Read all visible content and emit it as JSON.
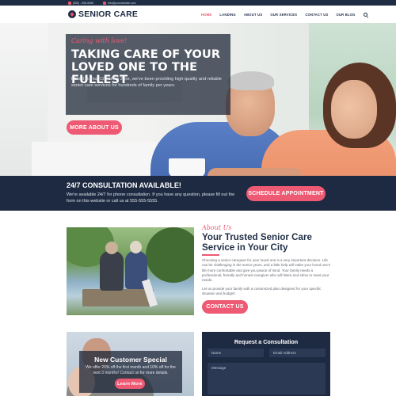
{
  "topbar": {
    "phone": "(555) - 555-5555",
    "email": "info@yourwebsite.com"
  },
  "header": {
    "logo_text": "SENIOR CARE",
    "nav": [
      {
        "label": "HOME"
      },
      {
        "label": "LANDING"
      },
      {
        "label": "ABOUT US"
      },
      {
        "label": "OUR SERVICES"
      },
      {
        "label": "CONTACT US"
      },
      {
        "label": "OUR BLOG"
      }
    ]
  },
  "hero": {
    "tagline": "Caring with love!",
    "title": "TAKING CARE OF YOUR LOVED ONE TO THE FULLEST",
    "description": "Based in Your City since 20xx, we've been providing high-quality and reliable senior care services for hundreds of family per years.",
    "button": "MORE ABOUT US"
  },
  "consultation_band": {
    "title": "24/7 CONSULTATION AVAILABLE!",
    "text": "We're available 24/7 for phone consultation. If you have any question, please fill out the form on this website or call us at 555-555-5555.",
    "button": "SCHEDULE APPOINTMENT"
  },
  "about": {
    "tag": "About Us",
    "title": "Your Trusted Senior Care Service in Your City",
    "paragraph1": "Choosing a senior caregiver for your loved one is a very important decision. Life can be challenging in the senior years, and a little help will make your loved one's life more comfortable and give you peace of mind. Your family needs a professional, friendly and honest caregiver who will listen and strive to meet your needs.",
    "paragraph2": "Let us provide your family with a customized plan designed for your specific situation and budget!",
    "button": "CONTACT US"
  },
  "special": {
    "title": "New Customer Special",
    "text": "We offer 20% off the first month and 10% off for the next 3 months! Contact us for more details.",
    "button": "Learn More"
  },
  "form": {
    "title": "Request a Consultation",
    "name_placeholder": "Name",
    "email_placeholder": "Email Address",
    "message_placeholder": "Message"
  },
  "colors": {
    "navy": "#1e2a41",
    "pink": "#ee5a73"
  }
}
